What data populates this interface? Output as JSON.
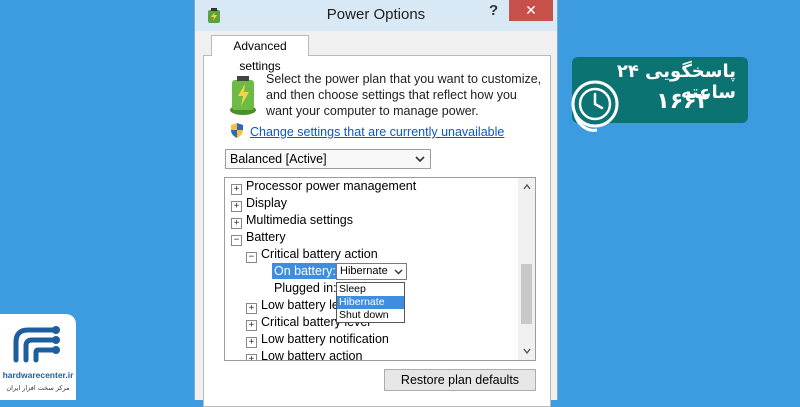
{
  "window": {
    "title": "Power Options",
    "help_label": "?",
    "close_label": "✕"
  },
  "tab": {
    "label": "Advanced settings"
  },
  "description": "Select the power plan that you want to customize, and then choose settings that reflect how you want your computer to manage power.",
  "change_link": "Change settings that are currently unavailable",
  "plan_select": {
    "value": "Balanced [Active]"
  },
  "tree": {
    "items": [
      {
        "label": "Processor power management",
        "toggle": "+"
      },
      {
        "label": "Display",
        "toggle": "+"
      },
      {
        "label": "Multimedia settings",
        "toggle": "+"
      },
      {
        "label": "Battery",
        "toggle": "−"
      },
      {
        "label": "Critical battery action",
        "toggle": "−"
      },
      {
        "label": "On battery:"
      },
      {
        "label": "Plugged in:"
      },
      {
        "label": "Low battery lev",
        "toggle": "+"
      },
      {
        "label": "Critical battery level",
        "toggle": "+"
      },
      {
        "label": "Low battery notification",
        "toggle": "+"
      },
      {
        "label": "Low battery action",
        "toggle": "+"
      }
    ],
    "on_battery_value": "Hibernate",
    "dropdown_options": [
      "Sleep",
      "Hibernate",
      "Shut down"
    ],
    "selected_option": "Hibernate"
  },
  "restore_button": "Restore plan defaults",
  "support": {
    "line1": "پاسخگویی ۲۴ ساعته",
    "line2": "۱۶۶۲"
  },
  "logo": {
    "name": "hardwarecenter.ir",
    "tagline": "مرکز سخت افزار ایران"
  },
  "colors": {
    "background": "#3d9be0",
    "link": "#0a58c8",
    "selection": "#3d8ee0",
    "banner": "#0c7373",
    "close": "#c7504a"
  }
}
